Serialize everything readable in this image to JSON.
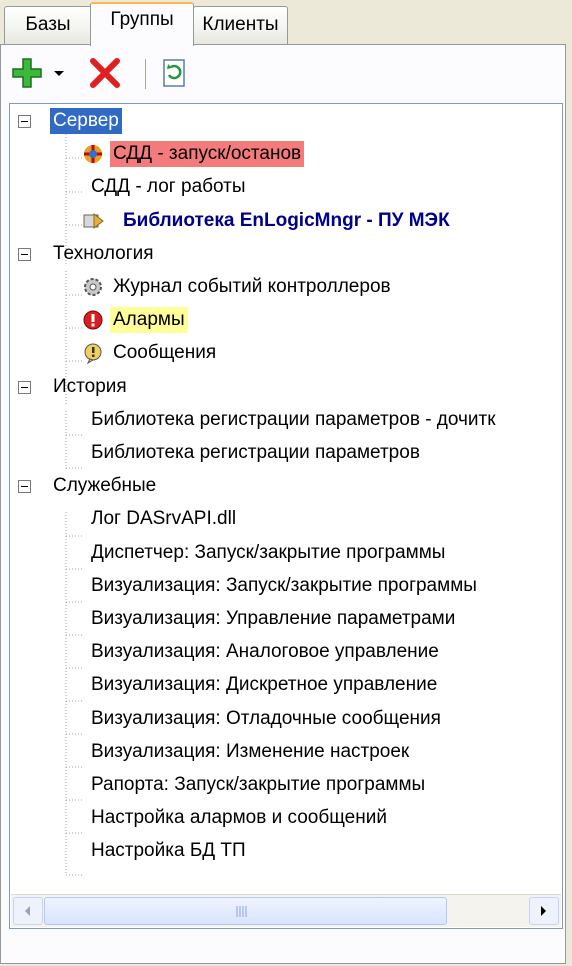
{
  "tabs": [
    {
      "label": "Базы"
    },
    {
      "label": "Группы"
    },
    {
      "label": "Клиенты"
    }
  ],
  "active_tab": "Группы",
  "toolbar": {
    "add_icon": "add-icon",
    "dropdown_icon": "chevron-down-icon",
    "delete_icon": "delete-icon",
    "refresh_icon": "refresh-icon"
  },
  "tree": {
    "groups": [
      {
        "label": "Сервер",
        "items": [
          {
            "label": "СДД - запуск/останов",
            "icon": "server-run-icon"
          },
          {
            "label": "СДД - лог работы",
            "icon": ""
          },
          {
            "label": "Библиотека EnLogicMngr - ПУ МЭК",
            "icon": "library-icon"
          }
        ]
      },
      {
        "label": "Технология",
        "items": [
          {
            "label": "Журнал событий контроллеров",
            "icon": "gear-icon"
          },
          {
            "label": "Алармы",
            "icon": "alarm-icon"
          },
          {
            "label": "Сообщения",
            "icon": "message-icon"
          }
        ]
      },
      {
        "label": "История",
        "items": [
          {
            "label": "Библиотека регистрации параметров - дочитк"
          },
          {
            "label": "Библиотека регистрации параметров"
          }
        ]
      },
      {
        "label": "Служебные",
        "items": [
          {
            "label": "Лог DASrvAPI.dll"
          },
          {
            "label": "Диспетчер: Запуск/закрытие программы"
          },
          {
            "label": "Визуализация: Запуск/закрытие программы"
          },
          {
            "label": "Визуализация: Управление параметрами"
          },
          {
            "label": "Визуализация: Аналоговое управление"
          },
          {
            "label": "Визуализация: Дискретное управление"
          },
          {
            "label": "Визуализация: Отладочные сообщения"
          },
          {
            "label": "Визуализация: Изменение настроек"
          },
          {
            "label": "Рапорта: Запуск/закрытие программы"
          },
          {
            "label": "Настройка алармов и сообщений"
          },
          {
            "label": "Настройка БД ТП"
          }
        ]
      }
    ]
  },
  "colors": {
    "selection": "#316ac5",
    "highlight_red": "#f47b7b",
    "highlight_yellow": "#ffff99",
    "bold_item": "#00008b"
  }
}
